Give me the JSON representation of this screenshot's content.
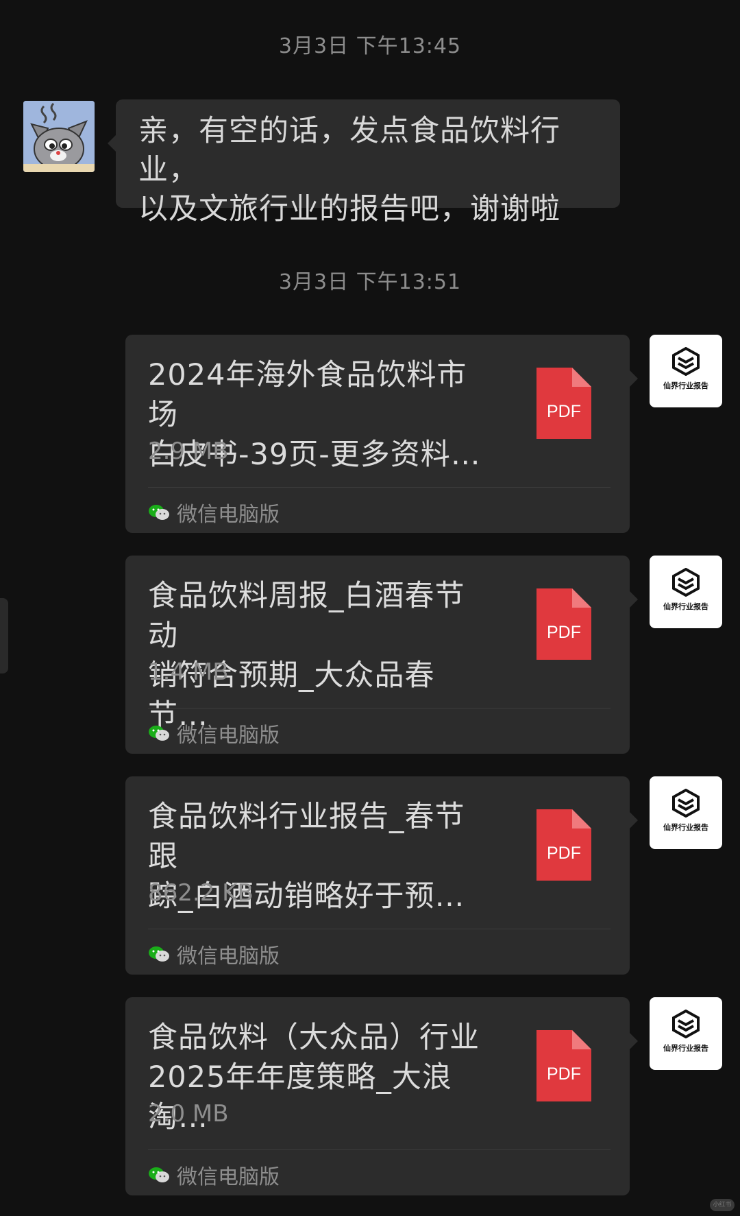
{
  "timestamps": [
    "3月3日 下午13:45",
    "3月3日 下午13:51"
  ],
  "incoming_message": {
    "lines": [
      "亲，有空的话，发点食品饮料行业，",
      "以及文旅行业的报告吧，谢谢啦"
    ]
  },
  "sender_logo_text": "仙界行业报告",
  "files": [
    {
      "name_lines": [
        "2024年海外食品饮料市场",
        "白皮书-39页-更多资料…"
      ],
      "size": "2.9 MB",
      "type_label": "PDF",
      "source": "微信电脑版"
    },
    {
      "name_lines": [
        "食品饮料周报_白酒春节动",
        "销符合预期_大众品春节…"
      ],
      "size": "1.4 MB",
      "type_label": "PDF",
      "source": "微信电脑版"
    },
    {
      "name_lines": [
        "食品饮料行业报告_春节跟",
        "踪_白酒动销略好于预…"
      ],
      "size": "862.2 KB",
      "type_label": "PDF",
      "source": "微信电脑版"
    },
    {
      "name_lines": [
        "食品饮料（大众品）行业",
        "2025年年度策略_大浪淘…"
      ],
      "size": "2.0 MB",
      "type_label": "PDF",
      "source": "微信电脑版"
    }
  ],
  "colors": {
    "background": "#111111",
    "bubble": "#2c2c2c",
    "pdf_red": "#e0393e",
    "wechat_green": "#1aad19"
  },
  "watermark": "小红书"
}
